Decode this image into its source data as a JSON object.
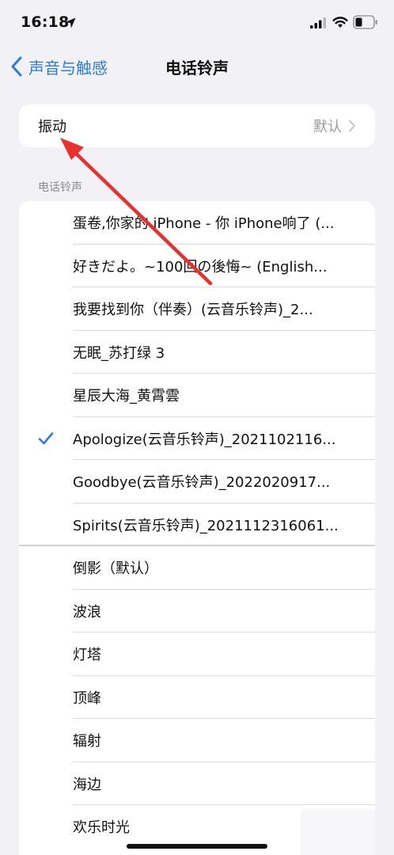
{
  "status_bar": {
    "time": "16:18",
    "icons": [
      "location-icon",
      "signal-icon",
      "wifi-icon",
      "battery-icon"
    ]
  },
  "nav": {
    "back_label": "声音与触感",
    "title": "电话铃声"
  },
  "vibration": {
    "label": "振动",
    "value": "默认"
  },
  "ringtone_section": {
    "header": "电话铃声",
    "custom_items": [
      {
        "label": "蛋卷,你家的 iPhone - 你 iPhone响了 (...",
        "selected": false
      },
      {
        "label": "好きだよ。~100回の後悔~ (English...",
        "selected": false
      },
      {
        "label": "我要找到你（伴奏）(云音乐铃声)_2...",
        "selected": false
      },
      {
        "label": "无眠_苏打绿 3",
        "selected": false
      },
      {
        "label": "星辰大海_黄霄雲",
        "selected": false
      },
      {
        "label": "Apologize(云音乐铃声)_2021102116...",
        "selected": true
      },
      {
        "label": "Goodbye(云音乐铃声)_2022020917...",
        "selected": false
      },
      {
        "label": "Spirits(云音乐铃声)_2021112316061...",
        "selected": false
      }
    ],
    "builtin_items": [
      {
        "label": "倒影（默认）"
      },
      {
        "label": "波浪"
      },
      {
        "label": "灯塔"
      },
      {
        "label": "顶峰"
      },
      {
        "label": "辐射"
      },
      {
        "label": "海边"
      },
      {
        "label": "欢乐时光"
      }
    ]
  },
  "colors": {
    "accent": "#2f7bd8",
    "background": "#f2f2f6",
    "annotation_arrow": "#e8302c"
  }
}
